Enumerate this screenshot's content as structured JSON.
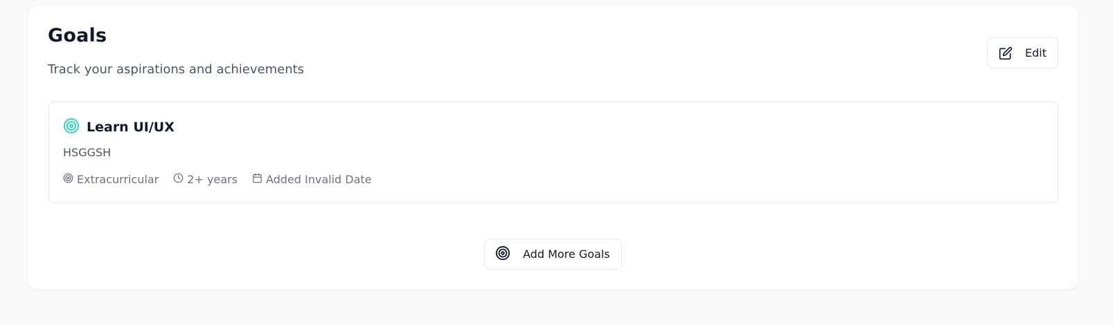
{
  "section": {
    "title": "Goals",
    "subtitle": "Track your aspirations and achievements",
    "edit_label": "Edit"
  },
  "goals": [
    {
      "title": "Learn UI/UX",
      "description": "HSGGSH",
      "category": "Extracurricular",
      "timeframe": "2+ years",
      "added": "Added Invalid Date"
    }
  ],
  "actions": {
    "add_more_label": "Add More Goals"
  },
  "icons": {
    "edit": "edit-pencil-square-icon",
    "goal": "target-icon",
    "category": "target-icon",
    "timeframe": "clock-icon",
    "added": "calendar-icon",
    "add_more": "target-icon"
  },
  "colors": {
    "accent": "#2dd4bf",
    "page_background": "#f8f9fb",
    "card_border": "#e5e7eb",
    "text_muted": "#6b7280"
  }
}
